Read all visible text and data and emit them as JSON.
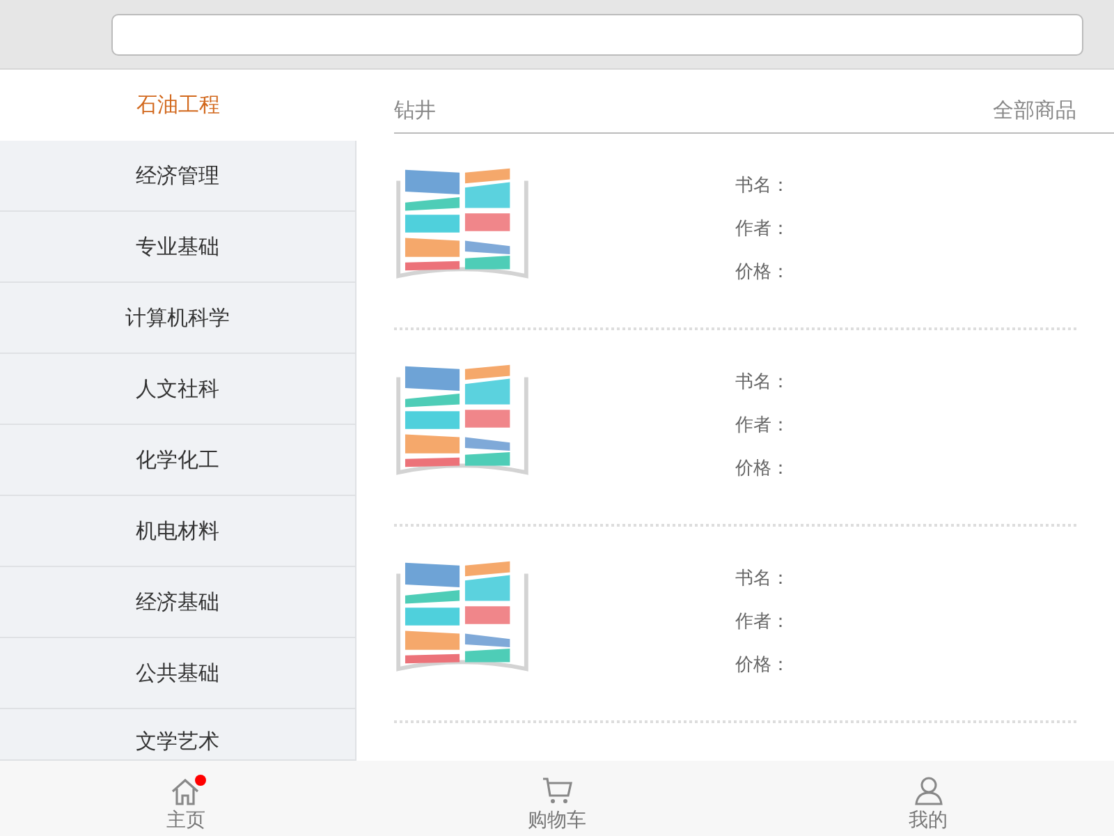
{
  "categories": [
    {
      "label": "石油工程",
      "selected": true
    },
    {
      "label": "经济管理",
      "selected": false
    },
    {
      "label": "专业基础",
      "selected": false
    },
    {
      "label": "计算机科学",
      "selected": false
    },
    {
      "label": "人文社科",
      "selected": false
    },
    {
      "label": "化学化工",
      "selected": false
    },
    {
      "label": "机电材料",
      "selected": false
    },
    {
      "label": "经济基础",
      "selected": false
    },
    {
      "label": "公共基础",
      "selected": false
    },
    {
      "label": "文学艺术",
      "selected": false
    }
  ],
  "section": {
    "title": "钻井",
    "link": "全部商品"
  },
  "books": [
    {
      "fields": [
        "书名：",
        "作者：",
        "价格："
      ]
    },
    {
      "fields": [
        "书名：",
        "作者：",
        "价格："
      ]
    },
    {
      "fields": [
        "书名：",
        "作者：",
        "价格："
      ]
    }
  ],
  "tab_bar": [
    {
      "kind": "home",
      "label": "主页",
      "dot": true
    },
    {
      "kind": "cart",
      "label": "购物车",
      "dot": false
    },
    {
      "kind": "user",
      "label": "我的",
      "dot": false
    }
  ]
}
